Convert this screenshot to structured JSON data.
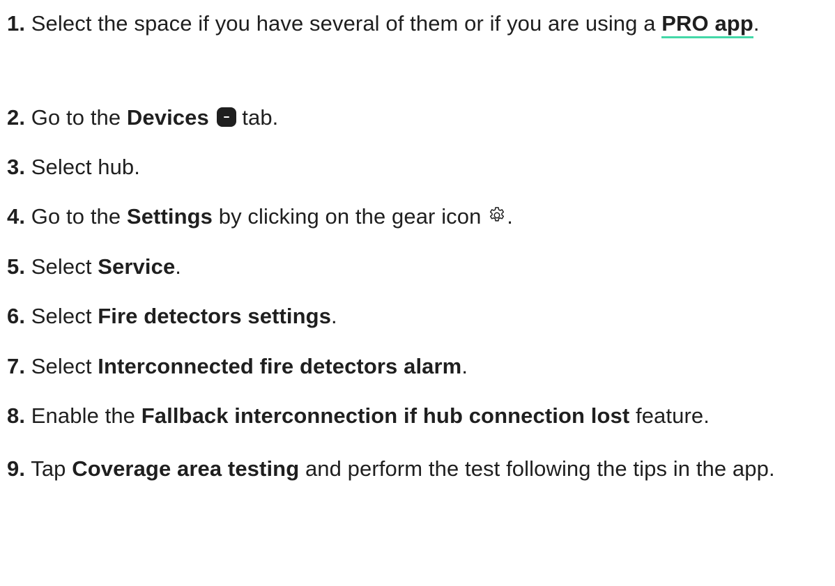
{
  "steps": [
    {
      "num": "1.",
      "text_a": "Select the space if you have several of them or if you are using a ",
      "link": "PRO app",
      "text_b": "."
    },
    {
      "num": "2.",
      "text_a": "Go to the ",
      "bold": "Devices",
      "icon": "devices-tab-icon",
      "text_b": " tab."
    },
    {
      "num": "3.",
      "text_a": "Select hub."
    },
    {
      "num": "4.",
      "text_a": "Go to the ",
      "bold": "Settings",
      "text_b": " by clicking on the gear icon ",
      "icon": "gear-icon",
      "text_c": "."
    },
    {
      "num": "5.",
      "text_a": "Select ",
      "bold": "Service",
      "text_b": "."
    },
    {
      "num": "6.",
      "text_a": "Select ",
      "bold": "Fire detectors settings",
      "text_b": "."
    },
    {
      "num": "7.",
      "text_a": "Select ",
      "bold": "Interconnected fire detectors alarm",
      "text_b": "."
    },
    {
      "num": "8.",
      "text_a": "Enable the ",
      "bold": "Fallback interconnection if hub connection lost",
      "text_b": " feature."
    },
    {
      "num": "9.",
      "text_a": "Tap ",
      "bold": "Coverage area testing",
      "text_b": " and perform the test following the tips in the app."
    }
  ],
  "colors": {
    "text": "#1f1f1f",
    "link_underline": "#44d8a8"
  }
}
